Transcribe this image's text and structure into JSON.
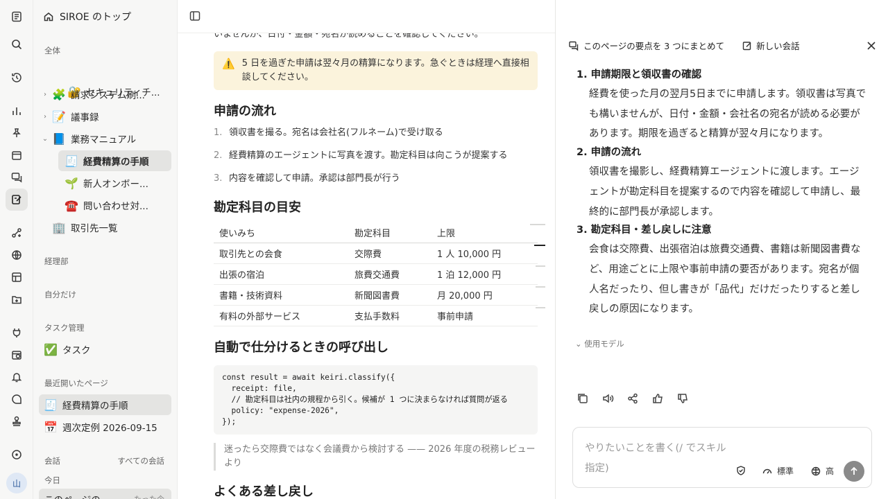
{
  "sidebar": {
    "top_link": "SIROE のトップ",
    "section_all": "全体",
    "items_all": [
      {
        "icon": "🔐",
        "label": "セキュリティチ..."
      },
      {
        "icon": "🧩",
        "label": "請求システム刷..."
      },
      {
        "icon": "📝",
        "label": "議事録"
      },
      {
        "icon": "📘",
        "label": "業務マニュアル"
      },
      {
        "icon": "🧾",
        "label": "経費精算の手順"
      },
      {
        "icon": "🌱",
        "label": "新人オンボー..."
      },
      {
        "icon": "☎️",
        "label": "問い合わせ対..."
      },
      {
        "icon": "🏢",
        "label": "取引先一覧"
      }
    ],
    "section_dept": "経理部",
    "section_mine": "自分だけ",
    "section_tasks": "タスク管理",
    "task_item": {
      "icon": "✅",
      "label": "タスク"
    },
    "section_recent": "最近開いたページ",
    "recent_items": [
      {
        "icon": "🧾",
        "label": "経費精算の手順"
      },
      {
        "icon": "📅",
        "label": "週次定例 2026-09-15"
      }
    ],
    "section_chats": "会話",
    "all_chats_link": "すべての会話",
    "section_today": "今日",
    "today_item": "このページの",
    "today_item_time": "たった今"
  },
  "rail": {
    "avatar": "山"
  },
  "doc": {
    "cut_line": "いませんが、日付・金額・宛名が読めることを確認してください。",
    "callout_icon": "⚠️",
    "callout": "5 日を過ぎた申請は翌々月の精算になります。急ぐときは経理へ直接相談してください。",
    "flow_heading": "申請の流れ",
    "steps": [
      {
        "num": "1.",
        "text": "領収書を撮る。宛名は会社名(フルネーム)で受け取る"
      },
      {
        "num": "2.",
        "text": "経費精算のエージェントに写真を渡す。勘定科目は向こうが提案する"
      },
      {
        "num": "3.",
        "text": "内容を確認して申請。承認は部門長が行う"
      }
    ],
    "accounts_heading": "勘定科目の目安",
    "table": {
      "headers": [
        "使いみち",
        "勘定科目",
        "上限"
      ],
      "rows": [
        [
          "取引先との会食",
          "交際費",
          "1 人 10,000 円"
        ],
        [
          "出張の宿泊",
          "旅費交通費",
          "1 泊 12,000 円"
        ],
        [
          "書籍・技術資料",
          "新聞図書費",
          "月 20,000 円"
        ],
        [
          "有料の外部サービス",
          "支払手数料",
          "事前申請"
        ]
      ]
    },
    "auto_heading": "自動で仕分けるときの呼び出し",
    "code": "const result = await keiri.classify({\n  receipt: file,\n  // 勘定科目は社内の規程から引く。候補が 1 つに決まらなければ質問が返る\n  policy: \"expense-2026\",\n});",
    "quote": "迷ったら交際費ではなく会議費から検討する —— 2026 年度の税務レビューより",
    "returns_heading": "よくある差し戻し"
  },
  "chat": {
    "summary_action": "このページの要点を 3 つにまとめて",
    "new_chat": "新しい会話",
    "answer": [
      {
        "num": "1.",
        "title": "申請期限と領収書の確認",
        "body": "経費を使った月の翌月5日までに申請します。領収書は写真でも構いませんが、日付・金額・会社名の宛名が読める必要があります。期限を過ぎると精算が翌々月になります。"
      },
      {
        "num": "2.",
        "title": "申請の流れ",
        "body": "領収書を撮影し、経費精算エージェントに渡します。エージェントが勘定科目を提案するので内容を確認して申請し、最終的に部門長が承認します。"
      },
      {
        "num": "3.",
        "title": "勘定科目・差し戻しに注意",
        "body": "会食は交際費、出張宿泊は旅費交通費、書籍は新聞図書費など、用途ごとに上限や事前申請の要否があります。宛名が個人名だったり、但し書きが「品代」だけだったりすると差し戻しの原因になります。"
      }
    ],
    "model_toggle": "使用モデル",
    "composer_placeholder": "やりたいことを書く(/ でスキル指定)",
    "mode_label": "標準",
    "level_label": "高"
  }
}
